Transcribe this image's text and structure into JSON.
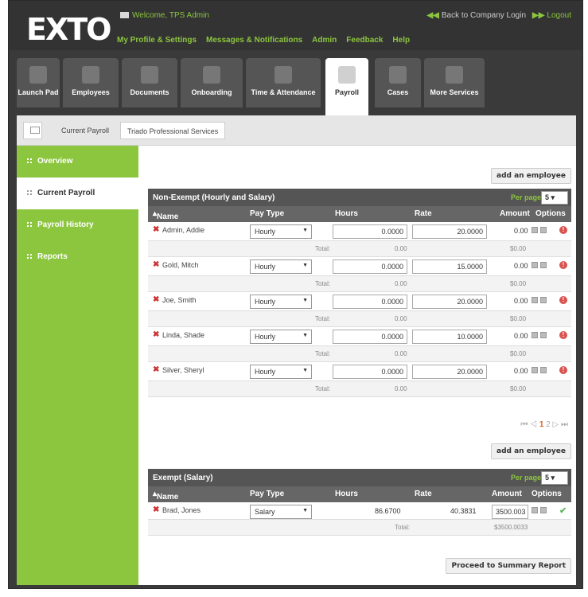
{
  "top": {
    "logo": "EXTO",
    "welcome": "Welcome, TPS Admin",
    "nav": [
      "My Profile & Settings",
      "Messages & Notifications",
      "Admin",
      "Feedback",
      "Help"
    ],
    "back_link": "Back to Company Login",
    "logout": "Logout",
    "arrow_left": "◀◀",
    "arrow_right": "▶▶"
  },
  "tabs": [
    "Launch Pad",
    "Employees",
    "Documents",
    "Onboarding",
    "Time & Attendance",
    "Payroll",
    "Cases",
    "More Services"
  ],
  "breadcrumb": [
    "Current Payroll",
    "Triado Professional Services"
  ],
  "sidebar": [
    "Overview",
    "Current Payroll",
    "Payroll History",
    "Reports"
  ],
  "buttons": {
    "add_employee": "add an employee",
    "summary": "Proceed to Summary Report"
  },
  "nonexempt": {
    "title": "Non-Exempt (Hourly and Salary)",
    "per_page_label": "Per page",
    "per_page": "5",
    "columns": [
      "Name",
      "Pay Type",
      "Hours",
      "Rate",
      "Amount",
      "Options"
    ],
    "rows": [
      {
        "name": "Admin, Addie",
        "type": "Hourly",
        "hours": "0.0000",
        "rate": "20.0000",
        "amount": "0.00",
        "total_label": "Total:",
        "total_hours": "0.00",
        "total_amount": "$0.00"
      },
      {
        "name": "Gold, Mitch",
        "type": "Hourly",
        "hours": "0.0000",
        "rate": "15.0000",
        "amount": "0.00",
        "total_label": "Total:",
        "total_hours": "0.00",
        "total_amount": "$0.00"
      },
      {
        "name": "Joe, Smith",
        "type": "Hourly",
        "hours": "0.0000",
        "rate": "20.0000",
        "amount": "0.00",
        "total_label": "Total:",
        "total_hours": "0.00",
        "total_amount": "$0.00"
      },
      {
        "name": "Linda, Shade",
        "type": "Hourly",
        "hours": "0.0000",
        "rate": "10.0000",
        "amount": "0.00",
        "total_label": "Total:",
        "total_hours": "0.00",
        "total_amount": "$0.00"
      },
      {
        "name": "Silver, Sheryl",
        "type": "Hourly",
        "hours": "0.0000",
        "rate": "20.0000",
        "amount": "0.00",
        "total_label": "Total:",
        "total_hours": "0.00",
        "total_amount": "$0.00"
      }
    ]
  },
  "pager": {
    "first": "⏮",
    "prev": "◁",
    "page1": "1",
    "page2": "2",
    "next": "▷",
    "last": "⏭"
  },
  "exempt": {
    "title": "Exempt (Salary)",
    "per_page_label": "Per page",
    "per_page": "5",
    "columns": [
      "Name",
      "Pay Type",
      "Hours",
      "Rate",
      "Amount",
      "Options"
    ],
    "rows": [
      {
        "name": "Brad, Jones",
        "type": "Salary",
        "hours": "86.6700",
        "rate": "40.3831",
        "amount": "3500.003",
        "total_label": "Total:",
        "total_amount": "$3500.0033"
      }
    ]
  }
}
